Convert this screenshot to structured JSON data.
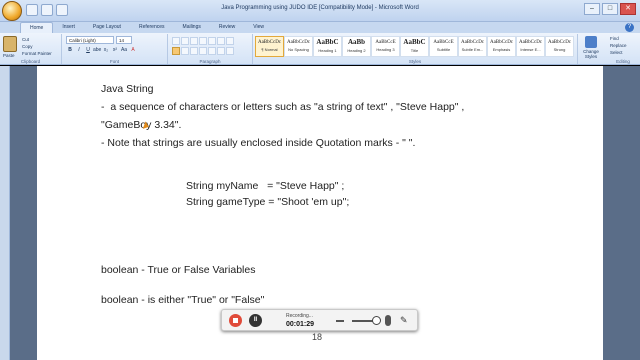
{
  "window": {
    "title": "Java Programming using JUDO IDE [Compatibility Mode] - Microsoft Word",
    "controls": [
      "–",
      "□",
      "✕"
    ]
  },
  "ribbon_tabs": [
    "Home",
    "Insert",
    "Page Layout",
    "References",
    "Mailings",
    "Review",
    "View"
  ],
  "clipboard": {
    "paste": "Paste",
    "cut": "Cut",
    "copy": "Copy",
    "format_painter": "Format Painter",
    "group": "Clipboard"
  },
  "font": {
    "name": "Calibri (Light)",
    "size": "14",
    "buttons": [
      "B",
      "I",
      "U",
      "abe",
      "x₂",
      "x²",
      "Aa",
      "A"
    ],
    "group": "Font"
  },
  "paragraph": {
    "group": "Paragraph"
  },
  "styles": {
    "items": [
      {
        "sample": "AaBbCcDc",
        "name": "¶ Normal"
      },
      {
        "sample": "AaBbCcDc",
        "name": "No Spacing"
      },
      {
        "sample": "AaBbC",
        "name": "Heading 1"
      },
      {
        "sample": "AaBb",
        "name": "Heading 2"
      },
      {
        "sample": "AaBbCcE",
        "name": "Heading 3"
      },
      {
        "sample": "AaBbC",
        "name": "Title"
      },
      {
        "sample": "AaBbCcE",
        "name": "Subtitle"
      },
      {
        "sample": "AaBbCcDc",
        "name": "Subtle Em..."
      },
      {
        "sample": "AaBbCcDc",
        "name": "Emphasis"
      },
      {
        "sample": "AaBbCcDc",
        "name": "Intense E..."
      },
      {
        "sample": "AaBbCcDc",
        "name": "Strong"
      }
    ],
    "change_styles": "Change Styles",
    "group": "Styles"
  },
  "editing": {
    "find": "Find",
    "replace": "Replace",
    "select": "Select",
    "group": "Editing"
  },
  "document": {
    "lines": [
      "Java String",
      "-  a sequence of characters or letters such as \"a string of text\" , \"Steve Happ\" ,",
      "\"GameBoy 3.34\".",
      "- Note that strings are usually enclosed inside Quotation marks - \" \".",
      "String myName   = \"Steve Happ\" ;",
      "String gameType = \"Shoot 'em up\";",
      "boolean - True or False Variables",
      "boolean - is either \"True\" or \"False\""
    ],
    "page_number": "18"
  },
  "recorder": {
    "status": "Recording...",
    "time": "00:01:29",
    "pause_label": "II"
  }
}
